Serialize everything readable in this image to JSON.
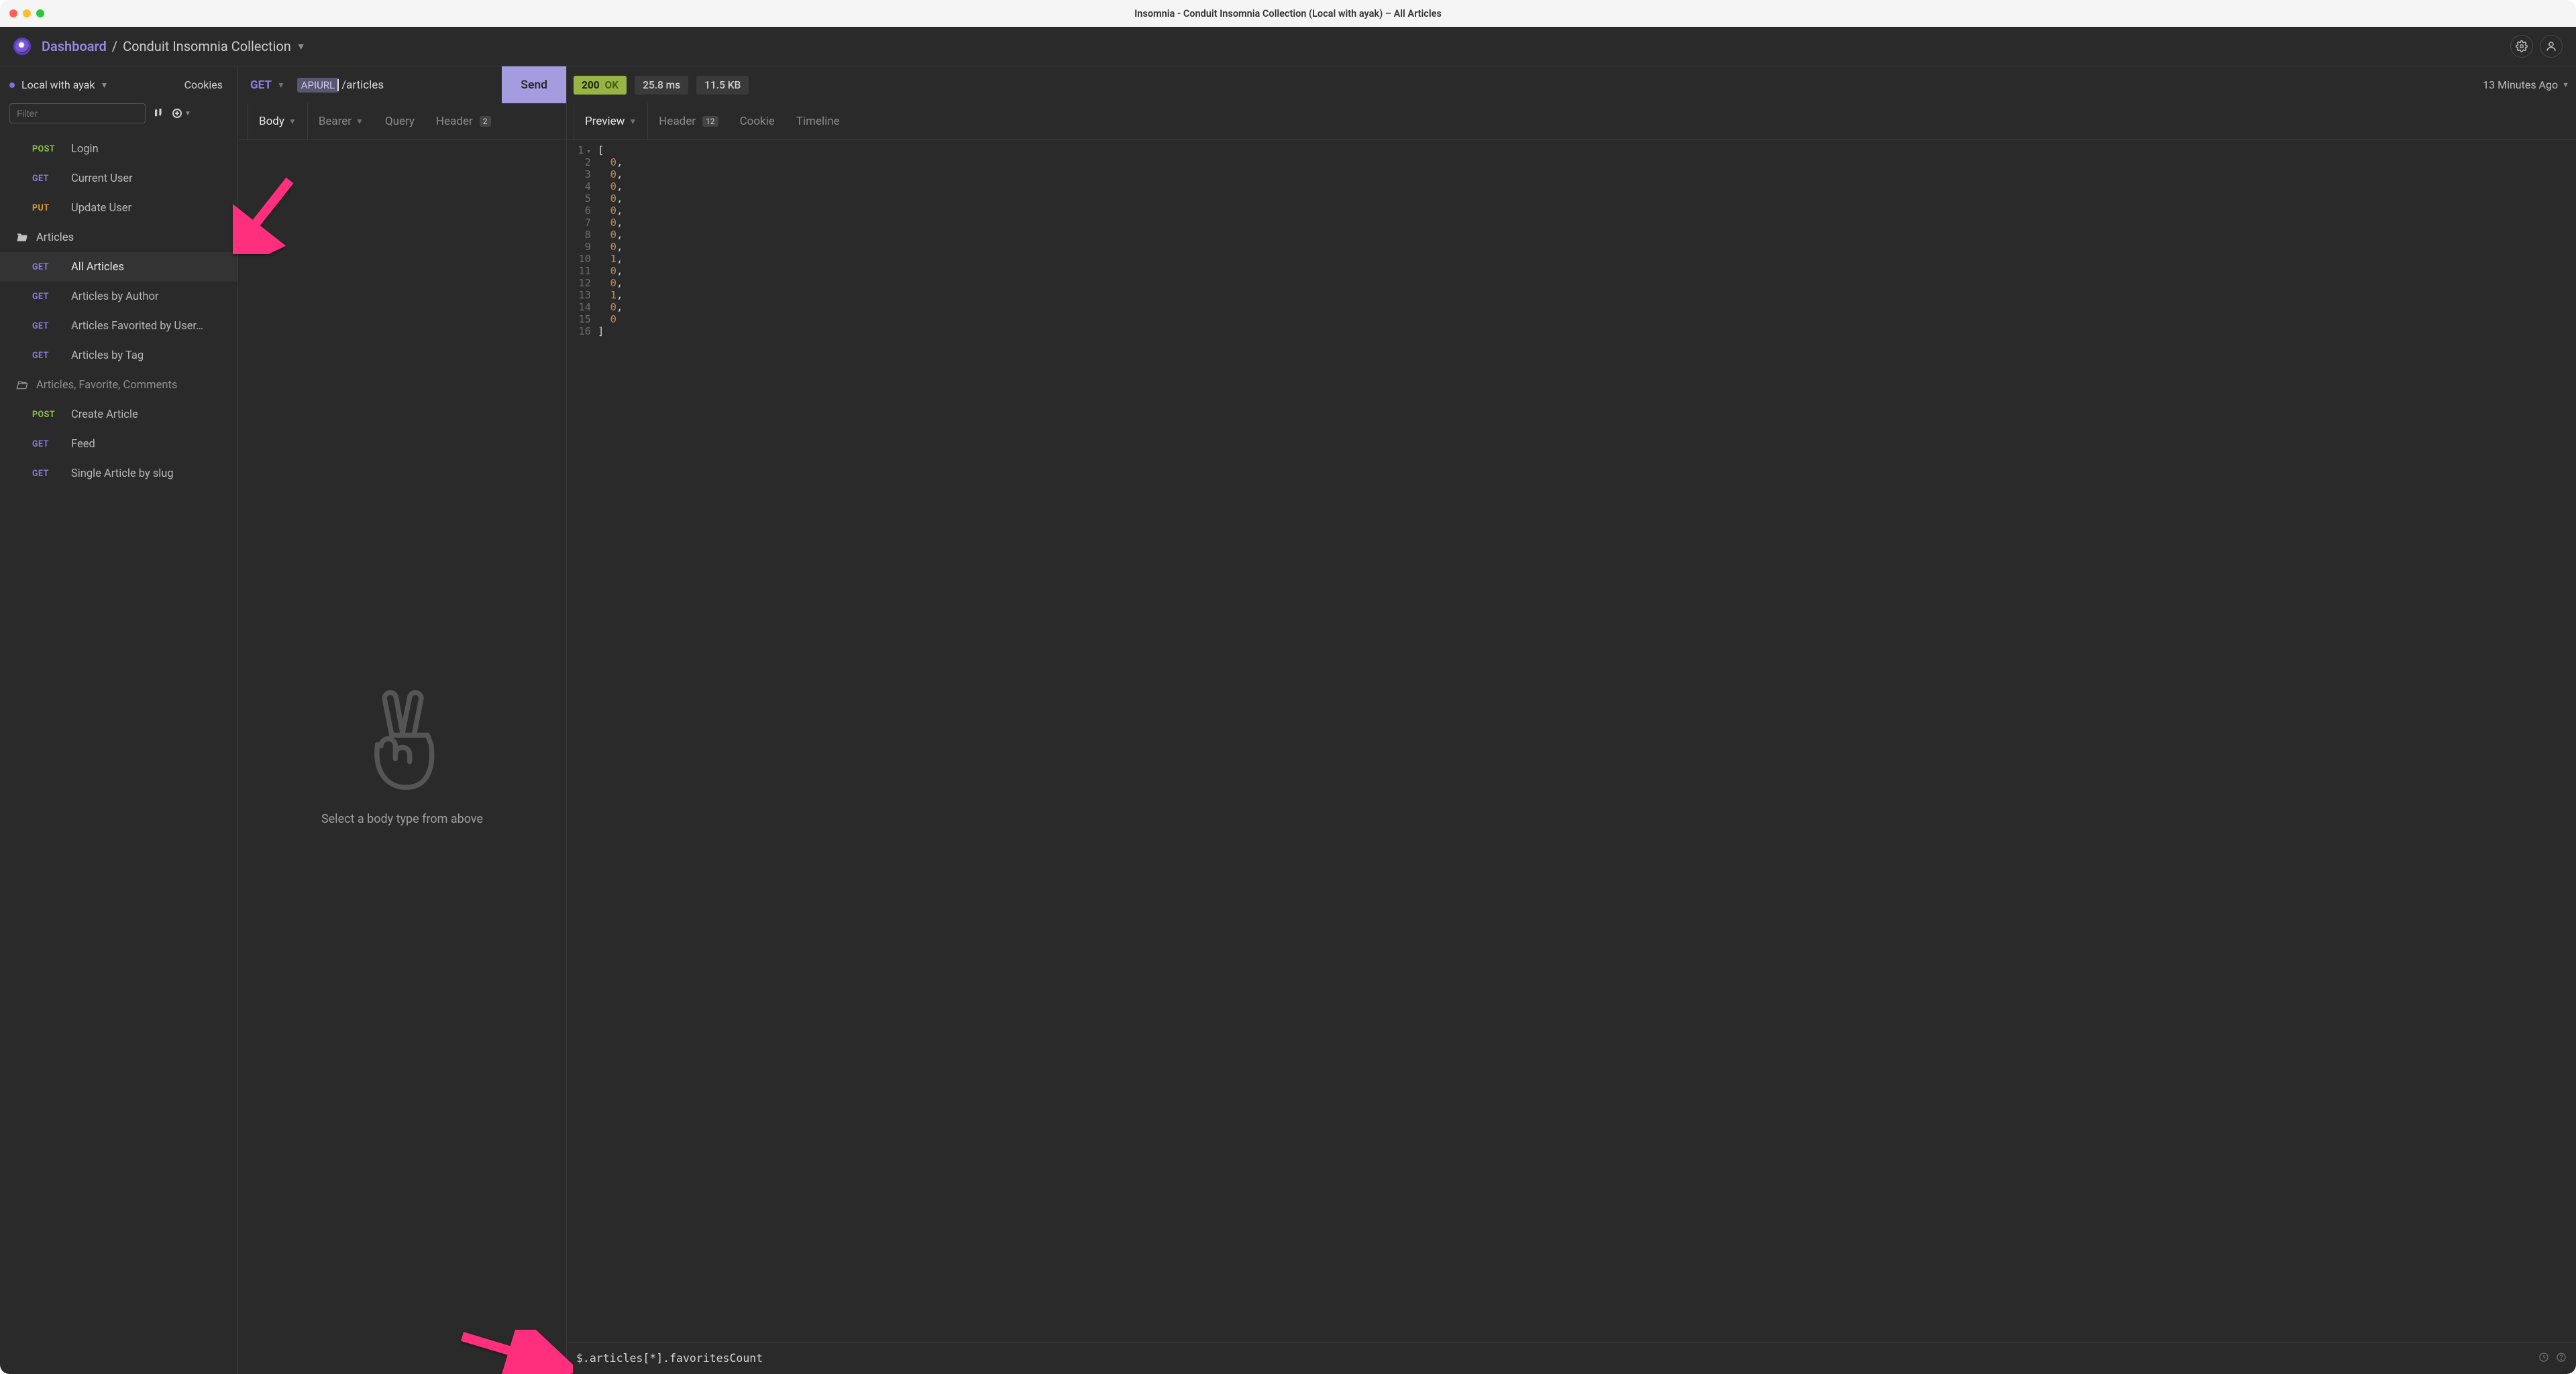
{
  "window": {
    "title": "Insomnia - Conduit Insomnia Collection (Local with ayak) – All Articles"
  },
  "breadcrumb": {
    "dashboard": "Dashboard",
    "separator": "/",
    "current": "Conduit Insomnia Collection"
  },
  "sidebar": {
    "env_label": "Local with ayak",
    "cookies": "Cookies",
    "filter_placeholder": "Filter",
    "items": [
      {
        "method": "POST",
        "method_class": "m-post",
        "label": "Login"
      },
      {
        "method": "GET",
        "method_class": "m-get",
        "label": "Current User"
      },
      {
        "method": "PUT",
        "method_class": "m-put",
        "label": "Update User"
      }
    ],
    "folder_articles": "Articles",
    "articles_items": [
      {
        "method": "GET",
        "method_class": "m-get",
        "label": "All Articles",
        "selected": true
      },
      {
        "method": "GET",
        "method_class": "m-get",
        "label": "Articles by Author"
      },
      {
        "method": "GET",
        "method_class": "m-get",
        "label": "Articles Favorited by User…"
      },
      {
        "method": "GET",
        "method_class": "m-get",
        "label": "Articles by Tag"
      }
    ],
    "folder_afc": "Articles, Favorite, Comments",
    "afc_items": [
      {
        "method": "POST",
        "method_class": "m-post",
        "label": "Create Article"
      },
      {
        "method": "GET",
        "method_class": "m-get",
        "label": "Feed"
      },
      {
        "method": "GET",
        "method_class": "m-get",
        "label": "Single Article by slug"
      }
    ]
  },
  "request": {
    "method": "GET",
    "url_tag": "APIURL",
    "url_path": "/articles",
    "send": "Send",
    "tabs": {
      "body": "Body",
      "auth": "Bearer",
      "query": "Query",
      "header": "Header",
      "header_count": "2"
    },
    "empty_msg": "Select a body type from above"
  },
  "response": {
    "status_code": "200",
    "status_text": "OK",
    "time": "25.8 ms",
    "size": "11.5 KB",
    "age": "13 Minutes Ago",
    "tabs": {
      "preview": "Preview",
      "header": "Header",
      "header_count": "12",
      "cookie": "Cookie",
      "timeline": "Timeline"
    },
    "json_lines": [
      {
        "n": "1",
        "content": "[",
        "punc": true,
        "fold": true
      },
      {
        "n": "2",
        "content": "0",
        "comma": true
      },
      {
        "n": "3",
        "content": "0",
        "comma": true
      },
      {
        "n": "4",
        "content": "0",
        "comma": true
      },
      {
        "n": "5",
        "content": "0",
        "comma": true
      },
      {
        "n": "6",
        "content": "0",
        "comma": true
      },
      {
        "n": "7",
        "content": "0",
        "comma": true
      },
      {
        "n": "8",
        "content": "0",
        "comma": true
      },
      {
        "n": "9",
        "content": "0",
        "comma": true
      },
      {
        "n": "10",
        "content": "1",
        "comma": true
      },
      {
        "n": "11",
        "content": "0",
        "comma": true
      },
      {
        "n": "12",
        "content": "0",
        "comma": true
      },
      {
        "n": "13",
        "content": "1",
        "comma": true
      },
      {
        "n": "14",
        "content": "0",
        "comma": true
      },
      {
        "n": "15",
        "content": "0",
        "comma": false
      },
      {
        "n": "16",
        "content": "]",
        "punc": true
      }
    ],
    "jsonpath": "$.articles[*].favoritesCount"
  }
}
